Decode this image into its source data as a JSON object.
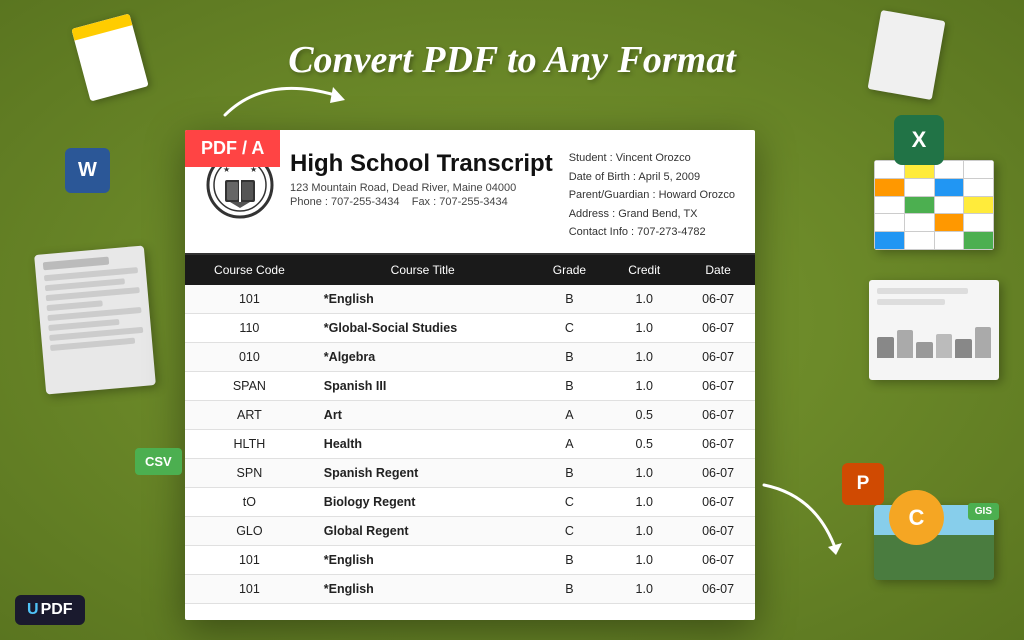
{
  "page": {
    "title": "Convert PDF to Any Format",
    "background_color": "#6b8a2a"
  },
  "badges": {
    "pdf_badge": "PDF / A",
    "csv_badge": "CSV",
    "excel_label": "X",
    "word_label": "W",
    "ppt_label": "P",
    "c_label": "C",
    "updf_label": "UPDF"
  },
  "transcript": {
    "title": "High School Transcript",
    "address": "123 Mountain Road, Dead River, Maine 04000",
    "phone": "Phone : 707-255-3434",
    "fax": "Fax : 707-255-3434",
    "student_name": "Student : Vincent Orozco",
    "dob": "Date of Birth : April 5,  2009",
    "parent": "Parent/Guardian : Howard Orozco",
    "address_student": "Address : Grand Bend, TX",
    "contact": "Contact Info : 707-273-4782"
  },
  "table": {
    "headers": [
      "Course Code",
      "Course Title",
      "Grade",
      "Credit",
      "Date"
    ],
    "rows": [
      {
        "code": "101",
        "title": "*English",
        "grade": "B",
        "credit": "1.0",
        "date": "06-07"
      },
      {
        "code": "110",
        "title": "*Global-Social Studies",
        "grade": "C",
        "credit": "1.0",
        "date": "06-07"
      },
      {
        "code": "010",
        "title": "*Algebra",
        "grade": "B",
        "credit": "1.0",
        "date": "06-07"
      },
      {
        "code": "SPAN",
        "title": "Spanish III",
        "grade": "B",
        "credit": "1.0",
        "date": "06-07"
      },
      {
        "code": "ART",
        "title": "Art",
        "grade": "A",
        "credit": "0.5",
        "date": "06-07"
      },
      {
        "code": "HLTH",
        "title": "Health",
        "grade": "A",
        "credit": "0.5",
        "date": "06-07"
      },
      {
        "code": "SPN",
        "title": "Spanish Regent",
        "grade": "B",
        "credit": "1.0",
        "date": "06-07"
      },
      {
        "code": "tO",
        "title": "Biology Regent",
        "grade": "C",
        "credit": "1.0",
        "date": "06-07"
      },
      {
        "code": "GLO",
        "title": "Global Regent",
        "grade": "C",
        "credit": "1.0",
        "date": "06-07"
      },
      {
        "code": "101",
        "title": "*English",
        "grade": "B",
        "credit": "1.0",
        "date": "06-07"
      },
      {
        "code": "101",
        "title": "*English",
        "grade": "B",
        "credit": "1.0",
        "date": "06-07"
      }
    ]
  }
}
